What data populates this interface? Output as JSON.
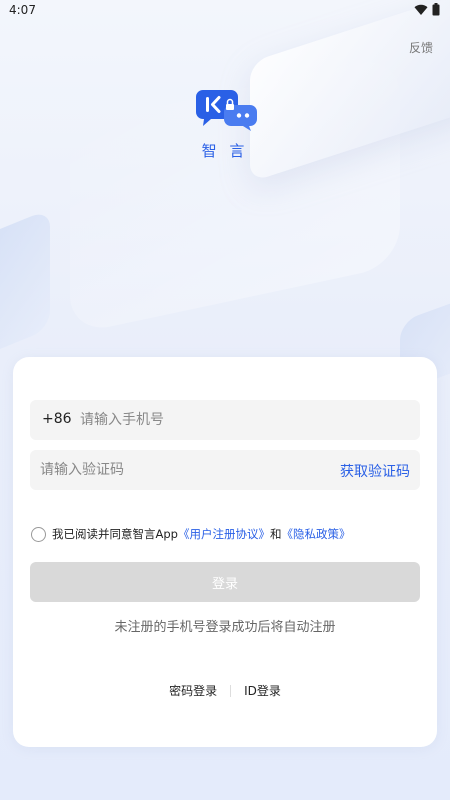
{
  "status_bar": {
    "time": "4:07",
    "wifi_icon": "wifi-icon",
    "battery_icon": "battery-icon"
  },
  "header": {
    "feedback_label": "反馈"
  },
  "app": {
    "name": "智 言",
    "logo_icon": "chat-bubbles-logo-icon"
  },
  "login_form": {
    "country_code": "+86",
    "phone_placeholder": "请输入手机号",
    "code_placeholder": "请输入验证码",
    "get_code_label": "获取验证码",
    "agreement": {
      "prefix": "我已阅读并同意智言App",
      "user_agreement": "《用户注册协议》",
      "conjunction": "和",
      "privacy_policy": "《隐私政策》"
    },
    "login_button": "登录",
    "hint": "未注册的手机号登录成功后将自动注册",
    "password_login": "密码登录",
    "id_login": "ID登录"
  },
  "colors": {
    "accent": "#2a60e6",
    "button_disabled": "#d9d9d9",
    "background": "#eef2fb"
  }
}
